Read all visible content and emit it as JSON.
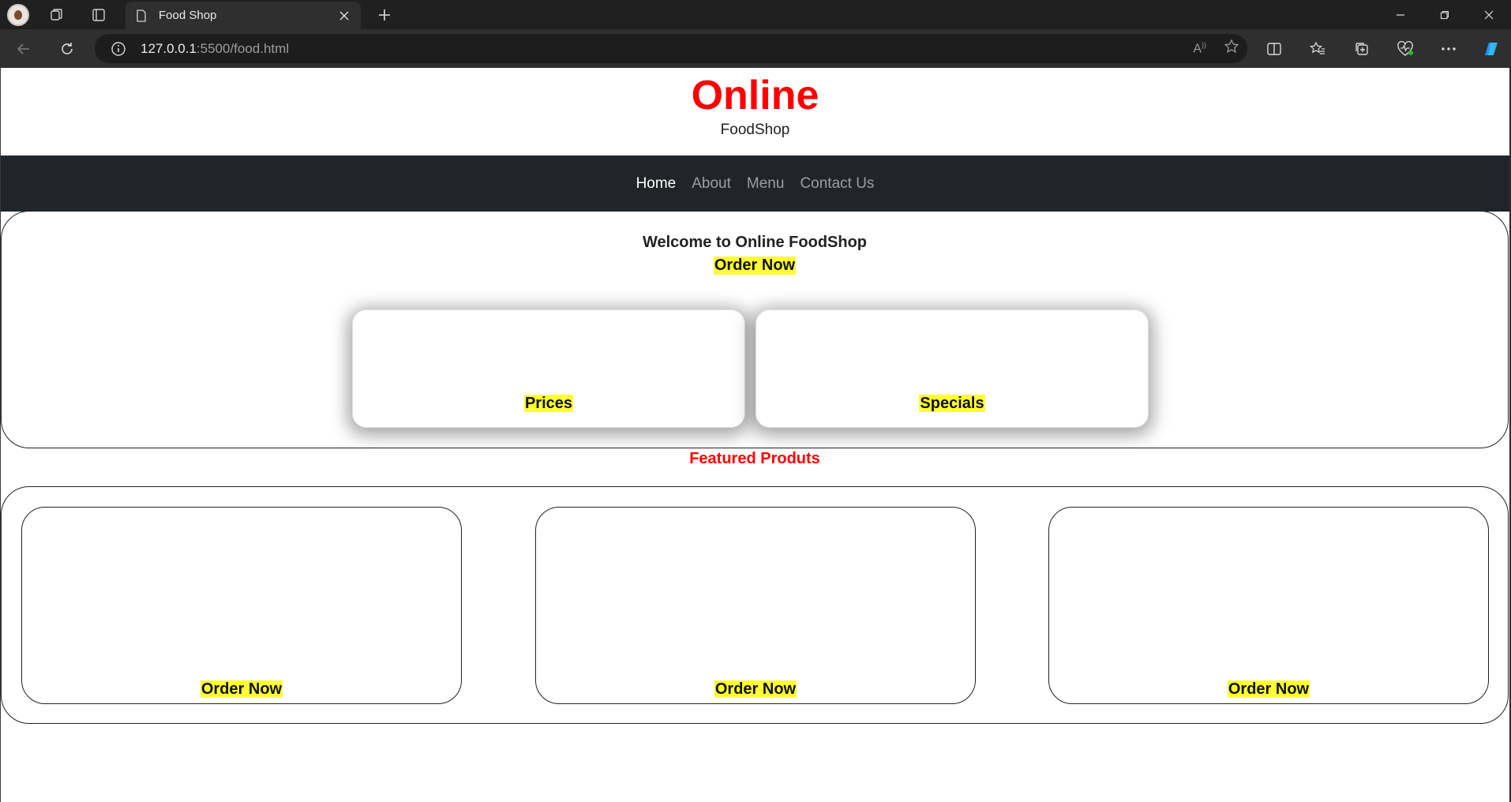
{
  "browser": {
    "tab_title": "Food Shop",
    "url_host": "127.0.0.1",
    "url_path": ":5500/food.html",
    "icons": [
      "profile-avatar",
      "workspaces-icon",
      "tab-actions-icon",
      "page-icon",
      "close-icon",
      "new-tab-icon",
      "minimize-icon",
      "maximize-icon",
      "window-close-icon",
      "back-icon",
      "reload-icon",
      "info-icon",
      "read-aloud-icon",
      "favorite-star-icon",
      "split-screen-icon",
      "favorites-icon",
      "collections-icon",
      "browser-essentials-icon",
      "more-icon",
      "copilot-icon"
    ]
  },
  "header": {
    "title": "Online",
    "subtitle": "FoodShop"
  },
  "nav": {
    "items": [
      "Home",
      "About",
      "Menu",
      "Contact Us"
    ],
    "active": "Home"
  },
  "hero": {
    "welcome": "Welcome to Online FoodShop",
    "order_label": "Order Now",
    "cards": [
      "Prices",
      "Specials"
    ]
  },
  "featured": {
    "title": "Featured Produts",
    "products": [
      {
        "button": "Order Now"
      },
      {
        "button": "Order Now"
      },
      {
        "button": "Order Now"
      }
    ]
  },
  "colors": {
    "brand_red": "#ff0000",
    "highlight_yellow": "#ffff33",
    "navbar_bg": "#212529"
  }
}
